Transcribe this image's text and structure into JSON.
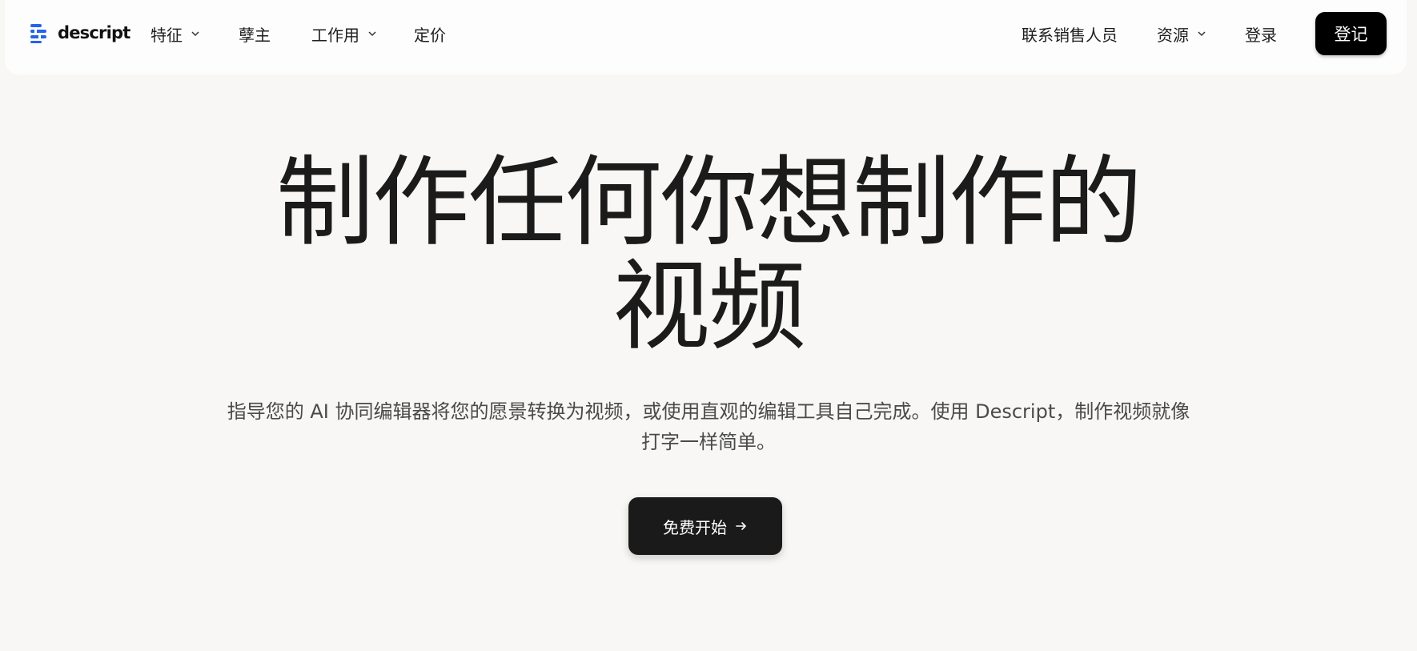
{
  "nav": {
    "logo_text": "descript",
    "items": [
      {
        "label": "特征",
        "has_dropdown": true
      },
      {
        "label": "孽主",
        "has_dropdown": false
      },
      {
        "label": "工作用",
        "has_dropdown": true
      },
      {
        "label": "定价",
        "has_dropdown": false
      }
    ],
    "right_items": [
      {
        "label": "联系销售人员",
        "has_dropdown": false
      },
      {
        "label": "资源",
        "has_dropdown": true
      },
      {
        "label": "登录",
        "has_dropdown": false
      }
    ],
    "signup_label": "登记"
  },
  "hero": {
    "title_line1": "制作任何你想制作的",
    "title_line2": "视频",
    "subtitle": "指导您的 AI 协同编辑器将您的愿景转换为视频，或使用直观的编辑工具自己完成。使用 Descript，制作视频就像打字一样简单。",
    "cta_label": "免费开始"
  },
  "icons": {
    "logo": "descript-logo-icon",
    "dropdown": "chevron-down-icon",
    "cta": "arrow-right-icon"
  },
  "colors": {
    "page_background": "#f8f7f5",
    "nav_background": "#fdfdfd",
    "logo_blue": "#2563eb",
    "button_dark": "#000000",
    "text_dark": "#1b1b1b",
    "text_muted": "#4a4a4a"
  }
}
